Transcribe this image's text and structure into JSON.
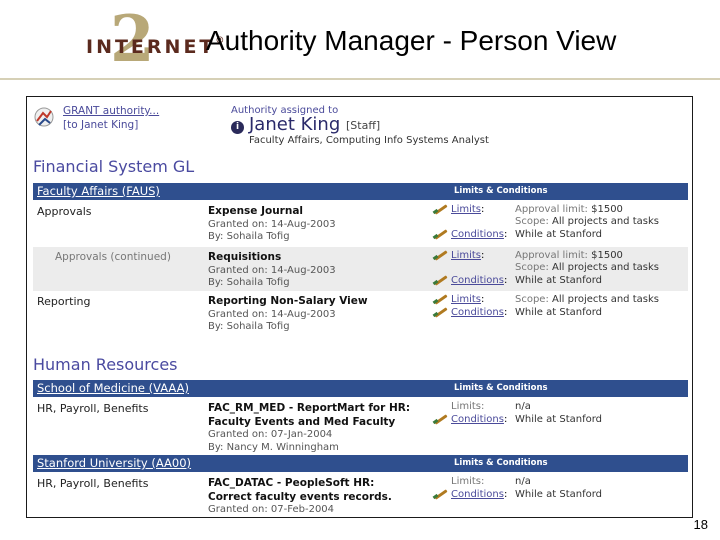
{
  "slide": {
    "logo_text": "INTERNET",
    "logo_numeral": "2",
    "logo_reg": "®",
    "title": "Authority Manager - Person View",
    "page_number": "18"
  },
  "header": {
    "grant_link": "GRANT authority...",
    "grant_target": "[to Janet King]",
    "assigned_label": "Authority assigned to",
    "person_name": "Janet King",
    "person_role": "[Staff]",
    "person_dept": "Faculty Affairs, Computing Info Systems Analyst"
  },
  "sections": [
    {
      "title": "Financial System GL",
      "groups": [
        {
          "name": "Faculty Affairs (FAUS)",
          "lc_header": "Limits & Conditions",
          "rows": [
            {
              "category": "Approvals",
              "title": "Expense Journal",
              "granted": "Granted on: 14-Aug-2003",
              "by": "By: Sohaila Tofig",
              "limits_label": "Limits",
              "limits_lines": [
                {
                  "label": "Approval limit:",
                  "value": "$1500"
                },
                {
                  "label": "Scope:",
                  "value": "All projects and tasks"
                }
              ],
              "conditions_label": "Conditions",
              "conditions_value": "While at Stanford"
            },
            {
              "category": "Approvals (continued)",
              "title": "Requisitions",
              "granted": "Granted on: 14-Aug-2003",
              "by": "By: Sohaila Tofig",
              "limits_label": "Limits",
              "limits_lines": [
                {
                  "label": "Approval limit:",
                  "value": "$1500"
                },
                {
                  "label": "Scope:",
                  "value": "All projects and tasks"
                }
              ],
              "conditions_label": "Conditions",
              "conditions_value": "While at Stanford"
            },
            {
              "category": "Reporting",
              "title": "Reporting Non-Salary View",
              "granted": "Granted on: 14-Aug-2003",
              "by": "By: Sohaila Tofig",
              "limits_label": "Limits",
              "limits_lines": [
                {
                  "label": "Scope:",
                  "value": "All projects and tasks"
                }
              ],
              "conditions_label": "Conditions",
              "conditions_value": "While at Stanford"
            }
          ]
        }
      ]
    },
    {
      "title": "Human Resources",
      "groups": [
        {
          "name": "School of Medicine (VAAA)",
          "lc_header": "Limits & Conditions",
          "rows": [
            {
              "category": "HR, Payroll, Benefits",
              "title": "FAC_RM_MED - ReportMart for HR: Faculty Events and Med Faculty",
              "title_line1": "FAC_RM_MED - ReportMart for HR:",
              "title_line2": "Faculty Events and Med Faculty",
              "granted": "Granted on: 07-Jan-2004",
              "by": "By: Nancy M. Winningham",
              "limits_label": "Limits:",
              "limits_value": "n/a",
              "conditions_label": "Conditions",
              "conditions_value": "While at Stanford"
            }
          ]
        },
        {
          "name": "Stanford University (AA00)",
          "lc_header": "Limits & Conditions",
          "rows": [
            {
              "category": "HR, Payroll, Benefits",
              "title_line1": "FAC_DATAC - PeopleSoft HR:",
              "title_line2": "Correct faculty events records.",
              "granted": "Granted on: 07-Feb-2004",
              "limits_label": "Limits:",
              "limits_value": "n/a",
              "conditions_label": "Conditions",
              "conditions_value": "While at Stanford"
            }
          ]
        }
      ]
    }
  ]
}
